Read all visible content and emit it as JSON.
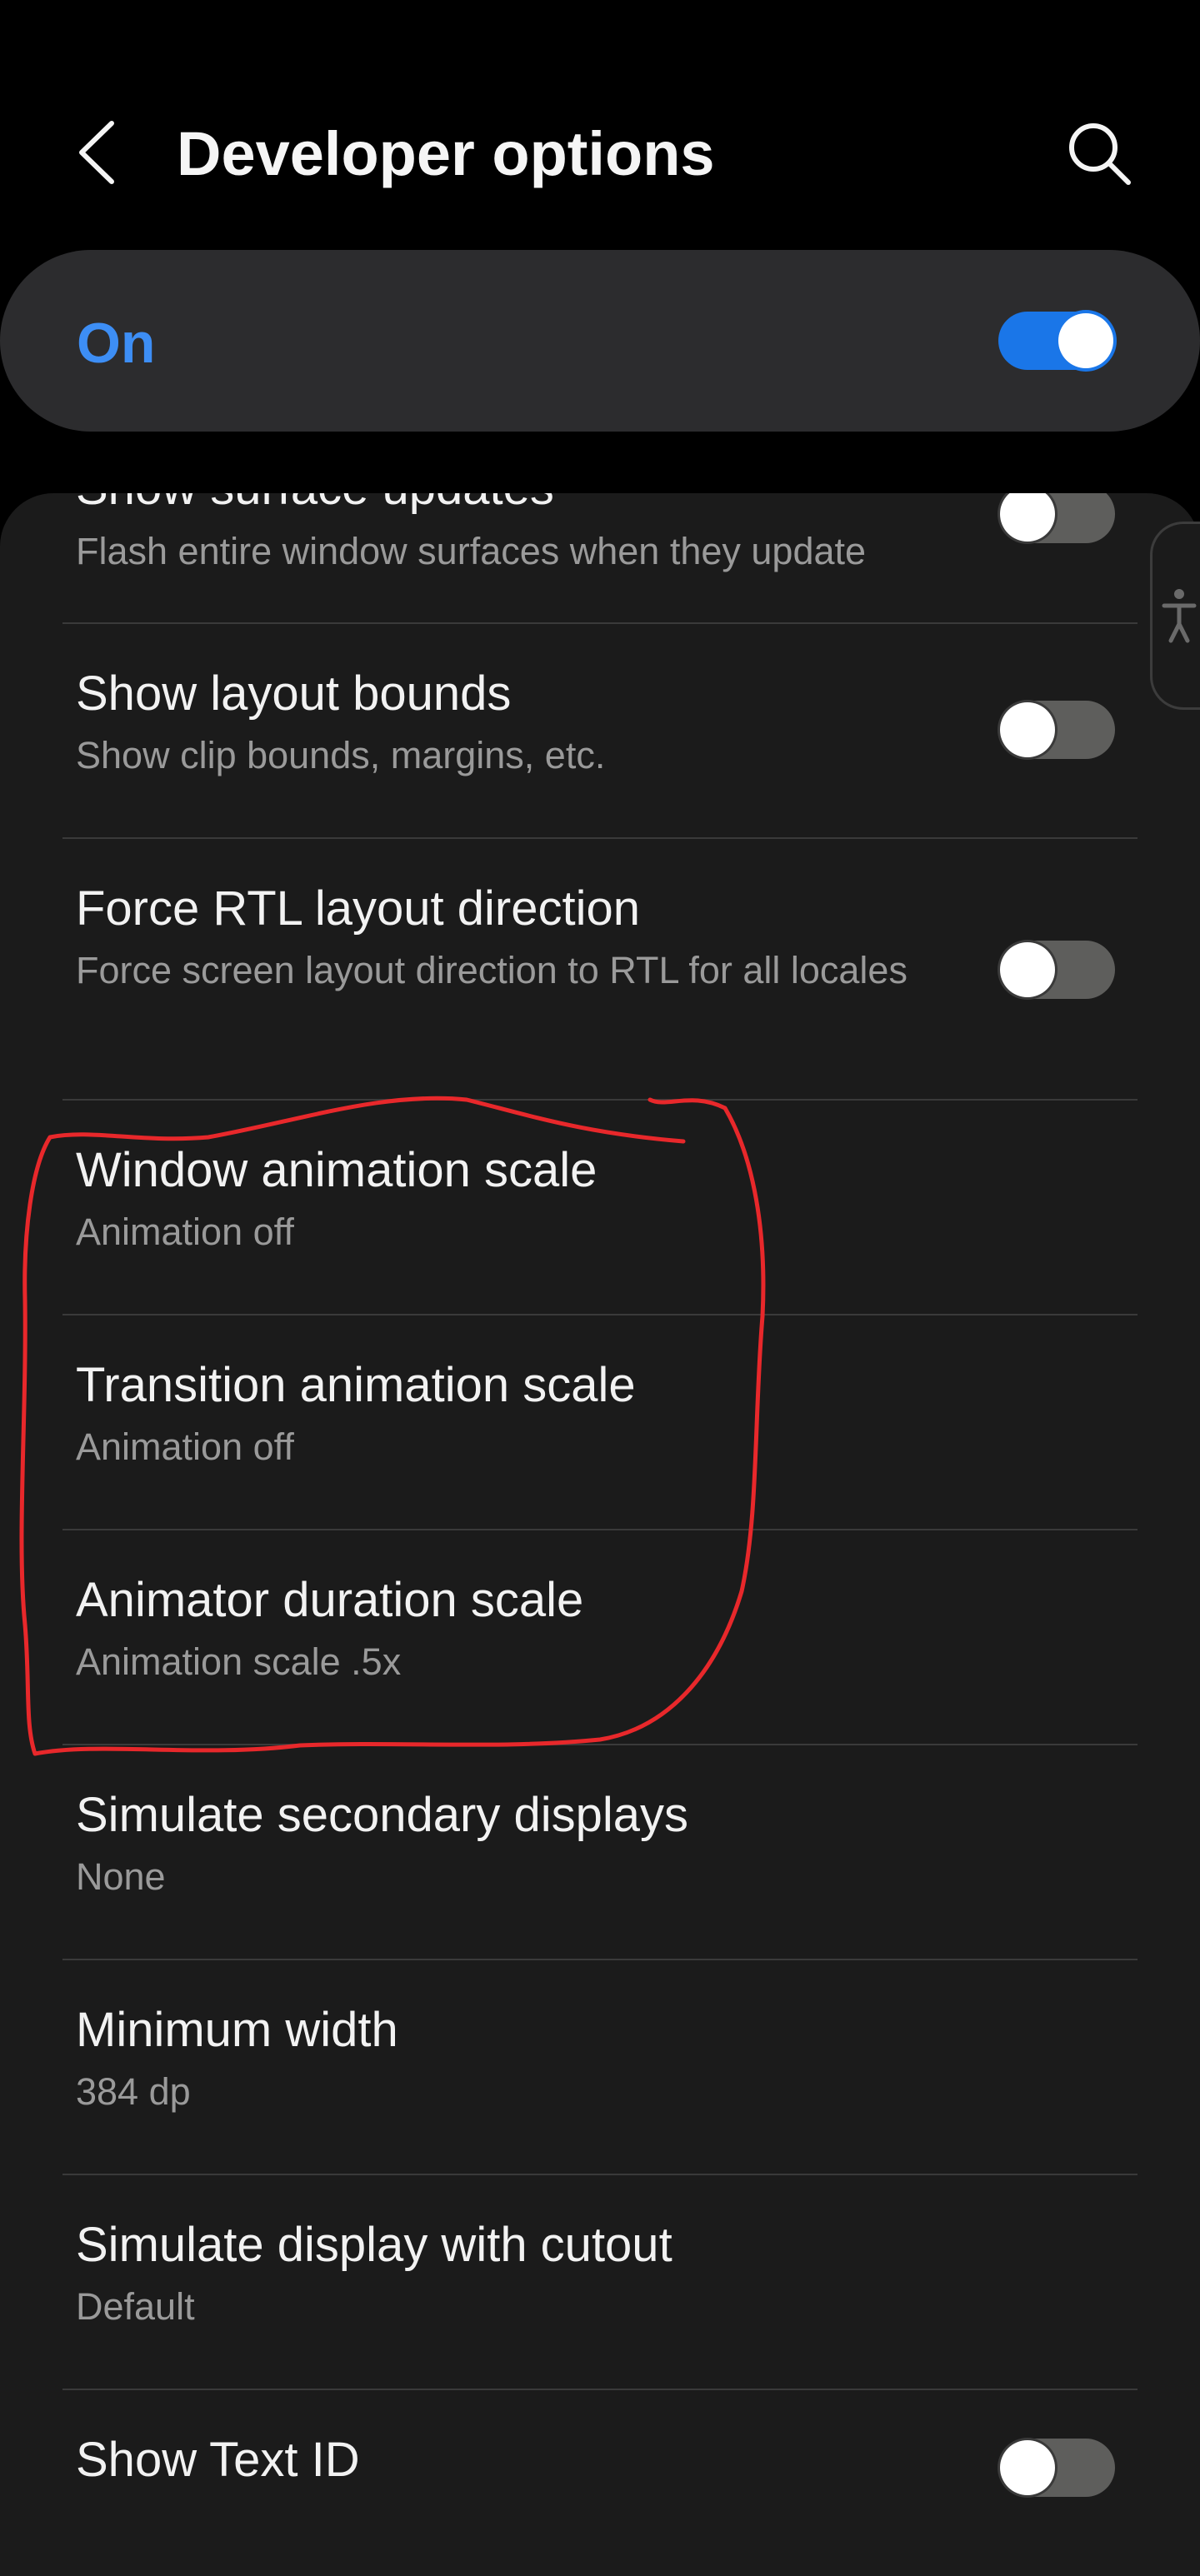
{
  "header": {
    "back_icon": "chevron-left-icon",
    "title": "Developer options",
    "search_icon": "search-icon"
  },
  "master_switch": {
    "label": "On",
    "state": "on",
    "accent_color": "#3d8ef5"
  },
  "settings": [
    {
      "title": "Show surface updates",
      "subtitle": "Flash entire window surfaces when they update",
      "toggle": "off"
    },
    {
      "title": "Show layout bounds",
      "subtitle": "Show clip bounds, margins, etc.",
      "toggle": "off"
    },
    {
      "title": "Force RTL layout direction",
      "subtitle": "Force screen layout direction to RTL for all locales",
      "toggle": "off"
    },
    {
      "title": "Window animation scale",
      "subtitle": "Animation off"
    },
    {
      "title": "Transition animation scale",
      "subtitle": "Animation off"
    },
    {
      "title": "Animator duration scale",
      "subtitle": "Animation scale .5x"
    },
    {
      "title": "Simulate secondary displays",
      "subtitle": "None"
    },
    {
      "title": "Minimum width",
      "subtitle": "384 dp"
    },
    {
      "title": "Simulate display with cutout",
      "subtitle": "Default"
    },
    {
      "title": "Show Text ID",
      "toggle": "off"
    }
  ],
  "side_tab": {
    "icon": "accessibility-icon"
  },
  "annotation": {
    "color": "#e8282b"
  }
}
